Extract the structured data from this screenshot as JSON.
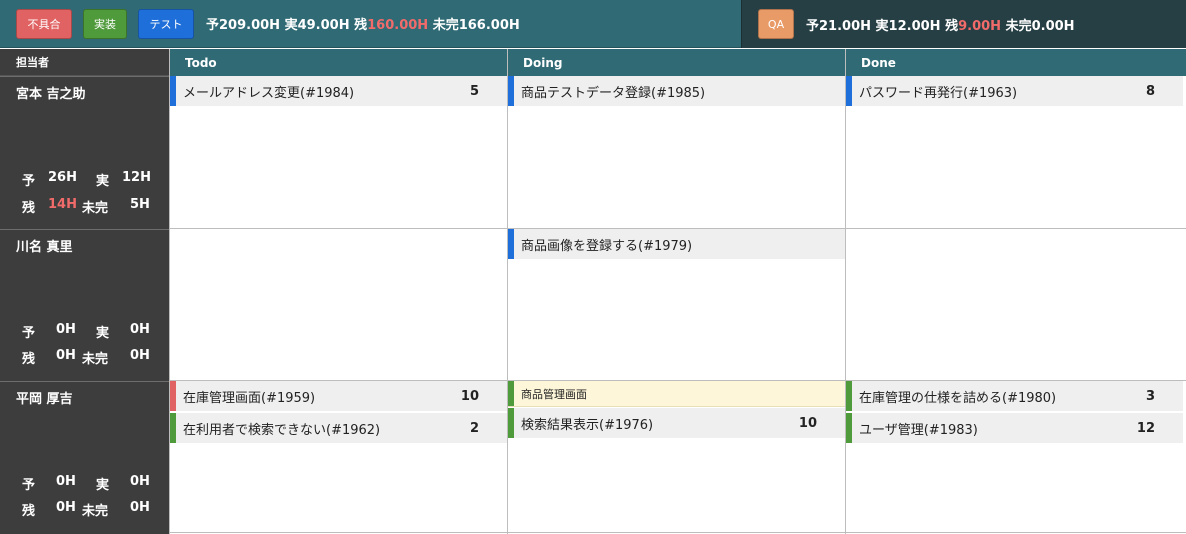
{
  "topbar": {
    "buttons": [
      {
        "label": "不具合",
        "color": "#e06262"
      },
      {
        "label": "実装",
        "color": "#4f9a3a"
      },
      {
        "label": "テスト",
        "color": "#1e6fd9"
      }
    ],
    "stats": {
      "plan": "予209.00H",
      "actual": "実49.00H",
      "remaining_prefix": "残",
      "remaining": "160.00H",
      "unfinished": "未完166.00H"
    },
    "qa": {
      "label": "QA",
      "color": "#e89a67",
      "stats": {
        "plan": "予21.00H",
        "actual": "実12.00H",
        "remaining_prefix": "残",
        "remaining": "9.00H",
        "unfinished": "未完0.00H"
      }
    }
  },
  "columns": {
    "person": "担当者",
    "todo": "Todo",
    "doing": "Doing",
    "done": "Done"
  },
  "people": [
    {
      "name": "宮本 吉之助",
      "plan_label": "予",
      "plan": "26H",
      "actual_label": "実",
      "actual": "12H",
      "remaining_label": "残",
      "remaining": "14H",
      "unfinished_label": "未完",
      "unfinished": "5H",
      "remaining_red": true
    },
    {
      "name": "川名 真里",
      "plan_label": "予",
      "plan": "0H",
      "actual_label": "実",
      "actual": "0H",
      "remaining_label": "残",
      "remaining": "0H",
      "unfinished_label": "未完",
      "unfinished": "0H",
      "remaining_red": false
    },
    {
      "name": "平岡 厚吉",
      "plan_label": "予",
      "plan": "0H",
      "actual_label": "実",
      "actual": "0H",
      "remaining_label": "残",
      "remaining": "0H",
      "unfinished_label": "未完",
      "unfinished": "0H",
      "remaining_red": false
    }
  ],
  "cards": {
    "r0_todo_0": {
      "title": "メールアドレス変更(#1984)",
      "points": "5",
      "stripe": "#1e6fd9"
    },
    "r0_doing_0": {
      "title": "商品テストデータ登録(#1985)",
      "points": "",
      "stripe": "#1e6fd9"
    },
    "r0_done_0": {
      "title": "パスワード再発行(#1963)",
      "points": "8",
      "stripe": "#1e6fd9"
    },
    "r1_doing_0": {
      "title": "商品画像を登録する(#1979)",
      "points": "",
      "stripe": "#1e6fd9"
    },
    "r2_todo_0": {
      "title": "在庫管理画面(#1959)",
      "points": "10",
      "stripe": "#e06262"
    },
    "r2_todo_1": {
      "title": "在利用者で検索できない(#1962)",
      "points": "2",
      "stripe": "#4f9a3a"
    },
    "r2_doing_group": {
      "title": "商品管理画面",
      "stripe": "#4f9a3a"
    },
    "r2_doing_0": {
      "title": "検索結果表示(#1976)",
      "points": "10",
      "stripe": "#4f9a3a"
    },
    "r2_done_0": {
      "title": "在庫管理の仕様を詰める(#1980)",
      "points": "3",
      "stripe": "#4f9a3a"
    },
    "r2_done_1": {
      "title": "ユーザ管理(#1983)",
      "points": "12",
      "stripe": "#4f9a3a"
    }
  }
}
